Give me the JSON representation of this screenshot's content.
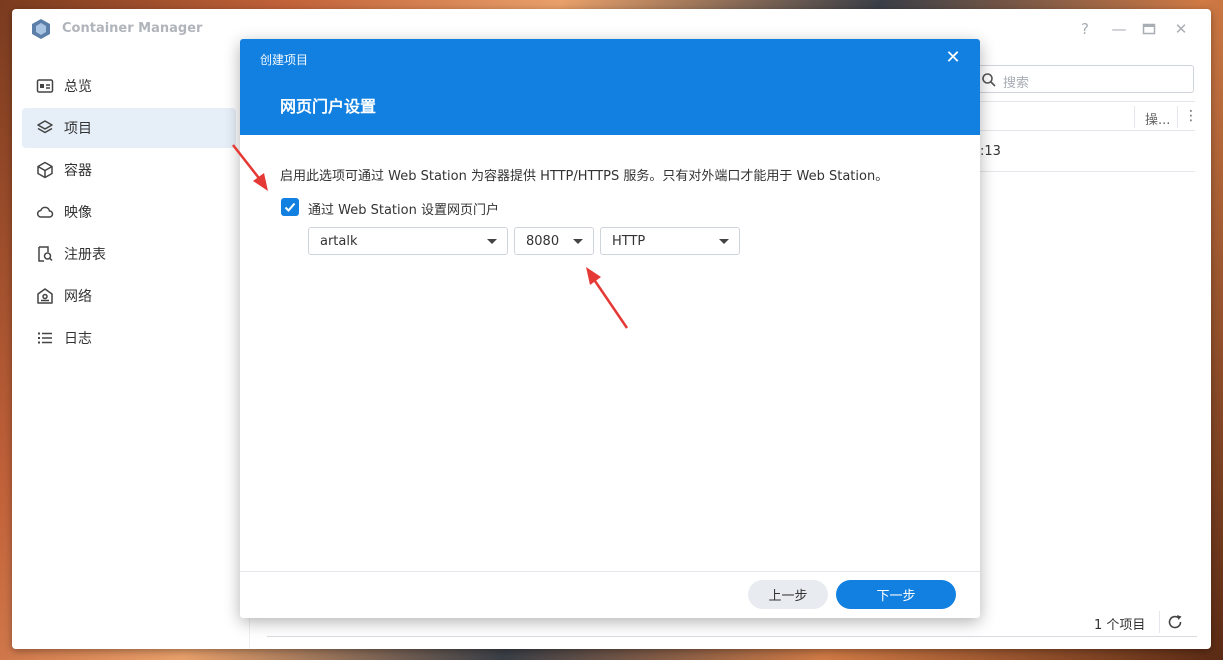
{
  "app": {
    "title": "Container Manager",
    "help_icon": "help-icon",
    "minimize_icon": "minimize-icon",
    "maximize_icon": "maximize-icon",
    "close_icon": "close-icon"
  },
  "sidebar": {
    "items": [
      {
        "label": "总览",
        "icon": "overview-icon",
        "active": false
      },
      {
        "label": "项目",
        "icon": "layers-icon",
        "active": true
      },
      {
        "label": "容器",
        "icon": "cube-icon",
        "active": false
      },
      {
        "label": "映像",
        "icon": "cloud-icon",
        "active": false
      },
      {
        "label": "注册表",
        "icon": "registry-search-icon",
        "active": false
      },
      {
        "label": "网络",
        "icon": "network-icon",
        "active": false
      },
      {
        "label": "日志",
        "icon": "list-icon",
        "active": false
      }
    ]
  },
  "background": {
    "search_placeholder": "搜索",
    "column_op": "操...",
    "row_fragment": ":13",
    "item_count": "1 个项目"
  },
  "modal": {
    "breadcrumb": "创建项目",
    "title": "网页门户设置",
    "description": "启用此选项可通过 Web Station 为容器提供 HTTP/HTTPS 服务。只有对外端口才能用于 Web Station。",
    "checkbox_label": "通过 Web Station 设置网页门户",
    "checkbox_checked": true,
    "service_select": "artalk",
    "port_select": "8080",
    "protocol_select": "HTTP",
    "prev_button": "上一步",
    "next_button": "下一步"
  },
  "colors": {
    "accent": "#1280e0",
    "annotation": "#e53935"
  }
}
